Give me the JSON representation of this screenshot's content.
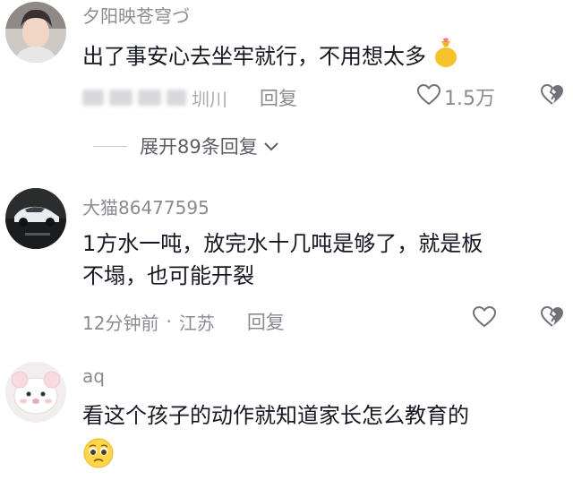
{
  "comments": [
    {
      "username": "夕阳映苍穹づ",
      "content": "出了事安心去坐牢就行，不用想太多",
      "content_emoji": "money-bag-emoji",
      "location_partial": "圳川",
      "reply_label": "回复",
      "like_count": "1.5万",
      "expand_label": "展开89条回复"
    },
    {
      "username": "大猫86477595",
      "content_line1": "1方水一吨，放完水十几吨是够了，就是板",
      "content_line2": "不塌，也可能开裂",
      "time": "12分钟前",
      "separator": "·",
      "location": "江苏",
      "reply_label": "回复"
    },
    {
      "username": "aq",
      "content": "看这个孩子的动作就知道家长怎么教育的",
      "content_emoji": "pleading-face-emoji"
    }
  ]
}
